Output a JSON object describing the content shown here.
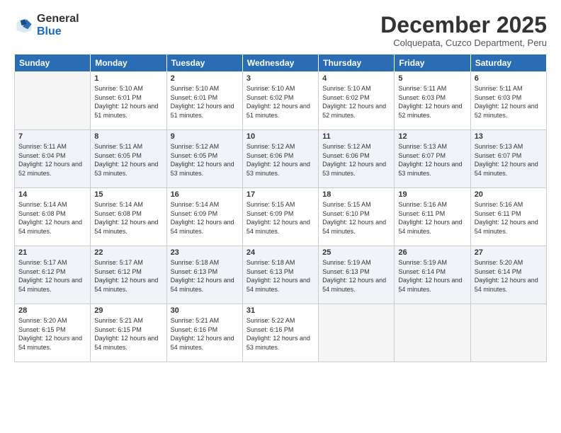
{
  "logo": {
    "general": "General",
    "blue": "Blue"
  },
  "header": {
    "month": "December 2025",
    "location": "Colquepata, Cuzco Department, Peru"
  },
  "weekdays": [
    "Sunday",
    "Monday",
    "Tuesday",
    "Wednesday",
    "Thursday",
    "Friday",
    "Saturday"
  ],
  "weeks": [
    [
      {
        "day": "",
        "sunrise": "",
        "sunset": "",
        "daylight": ""
      },
      {
        "day": "1",
        "sunrise": "5:10 AM",
        "sunset": "6:01 PM",
        "daylight": "12 hours and 51 minutes."
      },
      {
        "day": "2",
        "sunrise": "5:10 AM",
        "sunset": "6:01 PM",
        "daylight": "12 hours and 51 minutes."
      },
      {
        "day": "3",
        "sunrise": "5:10 AM",
        "sunset": "6:02 PM",
        "daylight": "12 hours and 51 minutes."
      },
      {
        "day": "4",
        "sunrise": "5:10 AM",
        "sunset": "6:02 PM",
        "daylight": "12 hours and 52 minutes."
      },
      {
        "day": "5",
        "sunrise": "5:11 AM",
        "sunset": "6:03 PM",
        "daylight": "12 hours and 52 minutes."
      },
      {
        "day": "6",
        "sunrise": "5:11 AM",
        "sunset": "6:03 PM",
        "daylight": "12 hours and 52 minutes."
      }
    ],
    [
      {
        "day": "7",
        "sunrise": "5:11 AM",
        "sunset": "6:04 PM",
        "daylight": "12 hours and 52 minutes."
      },
      {
        "day": "8",
        "sunrise": "5:11 AM",
        "sunset": "6:05 PM",
        "daylight": "12 hours and 53 minutes."
      },
      {
        "day": "9",
        "sunrise": "5:12 AM",
        "sunset": "6:05 PM",
        "daylight": "12 hours and 53 minutes."
      },
      {
        "day": "10",
        "sunrise": "5:12 AM",
        "sunset": "6:06 PM",
        "daylight": "12 hours and 53 minutes."
      },
      {
        "day": "11",
        "sunrise": "5:12 AM",
        "sunset": "6:06 PM",
        "daylight": "12 hours and 53 minutes."
      },
      {
        "day": "12",
        "sunrise": "5:13 AM",
        "sunset": "6:07 PM",
        "daylight": "12 hours and 53 minutes."
      },
      {
        "day": "13",
        "sunrise": "5:13 AM",
        "sunset": "6:07 PM",
        "daylight": "12 hours and 54 minutes."
      }
    ],
    [
      {
        "day": "14",
        "sunrise": "5:14 AM",
        "sunset": "6:08 PM",
        "daylight": "12 hours and 54 minutes."
      },
      {
        "day": "15",
        "sunrise": "5:14 AM",
        "sunset": "6:08 PM",
        "daylight": "12 hours and 54 minutes."
      },
      {
        "day": "16",
        "sunrise": "5:14 AM",
        "sunset": "6:09 PM",
        "daylight": "12 hours and 54 minutes."
      },
      {
        "day": "17",
        "sunrise": "5:15 AM",
        "sunset": "6:09 PM",
        "daylight": "12 hours and 54 minutes."
      },
      {
        "day": "18",
        "sunrise": "5:15 AM",
        "sunset": "6:10 PM",
        "daylight": "12 hours and 54 minutes."
      },
      {
        "day": "19",
        "sunrise": "5:16 AM",
        "sunset": "6:11 PM",
        "daylight": "12 hours and 54 minutes."
      },
      {
        "day": "20",
        "sunrise": "5:16 AM",
        "sunset": "6:11 PM",
        "daylight": "12 hours and 54 minutes."
      }
    ],
    [
      {
        "day": "21",
        "sunrise": "5:17 AM",
        "sunset": "6:12 PM",
        "daylight": "12 hours and 54 minutes."
      },
      {
        "day": "22",
        "sunrise": "5:17 AM",
        "sunset": "6:12 PM",
        "daylight": "12 hours and 54 minutes."
      },
      {
        "day": "23",
        "sunrise": "5:18 AM",
        "sunset": "6:13 PM",
        "daylight": "12 hours and 54 minutes."
      },
      {
        "day": "24",
        "sunrise": "5:18 AM",
        "sunset": "6:13 PM",
        "daylight": "12 hours and 54 minutes."
      },
      {
        "day": "25",
        "sunrise": "5:19 AM",
        "sunset": "6:13 PM",
        "daylight": "12 hours and 54 minutes."
      },
      {
        "day": "26",
        "sunrise": "5:19 AM",
        "sunset": "6:14 PM",
        "daylight": "12 hours and 54 minutes."
      },
      {
        "day": "27",
        "sunrise": "5:20 AM",
        "sunset": "6:14 PM",
        "daylight": "12 hours and 54 minutes."
      }
    ],
    [
      {
        "day": "28",
        "sunrise": "5:20 AM",
        "sunset": "6:15 PM",
        "daylight": "12 hours and 54 minutes."
      },
      {
        "day": "29",
        "sunrise": "5:21 AM",
        "sunset": "6:15 PM",
        "daylight": "12 hours and 54 minutes."
      },
      {
        "day": "30",
        "sunrise": "5:21 AM",
        "sunset": "6:16 PM",
        "daylight": "12 hours and 54 minutes."
      },
      {
        "day": "31",
        "sunrise": "5:22 AM",
        "sunset": "6:16 PM",
        "daylight": "12 hours and 53 minutes."
      },
      {
        "day": "",
        "sunrise": "",
        "sunset": "",
        "daylight": ""
      },
      {
        "day": "",
        "sunrise": "",
        "sunset": "",
        "daylight": ""
      },
      {
        "day": "",
        "sunrise": "",
        "sunset": "",
        "daylight": ""
      }
    ]
  ],
  "labels": {
    "sunrise": "Sunrise:",
    "sunset": "Sunset:",
    "daylight": "Daylight:"
  }
}
